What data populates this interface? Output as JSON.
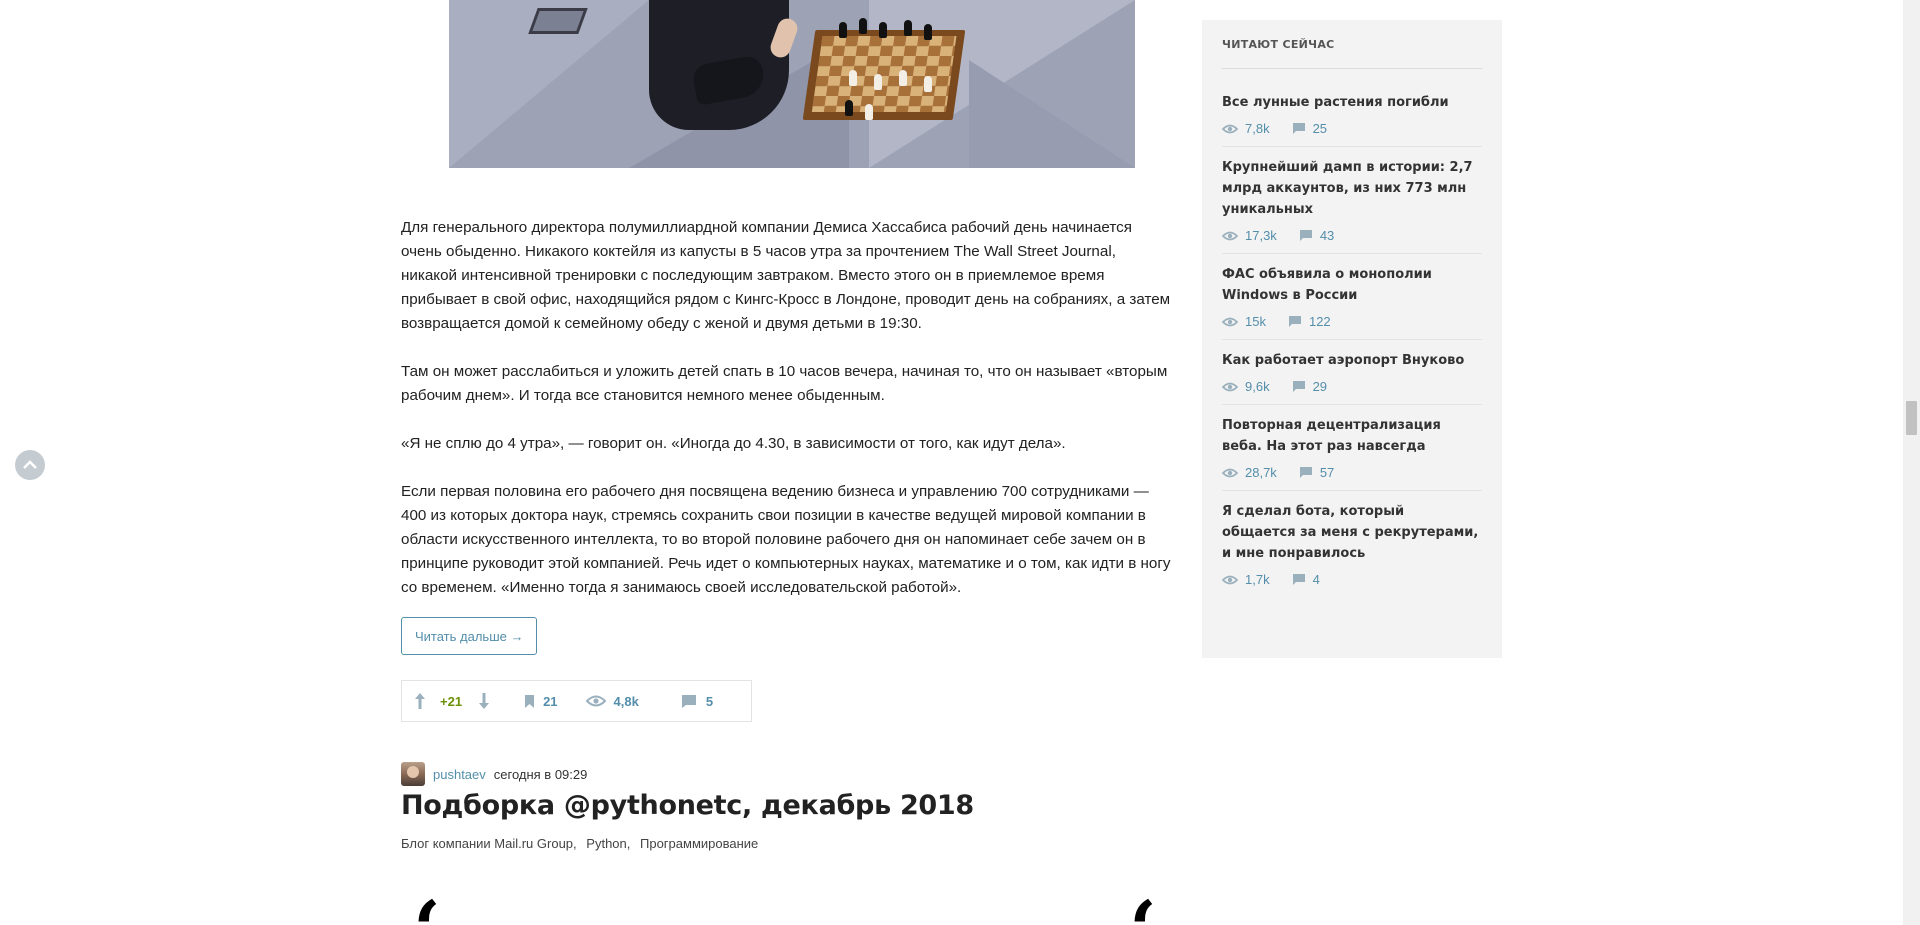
{
  "article": {
    "paragraphs": [
      "Для генерального директора полумиллиардной компании Демиса Хассабиса рабочий день начинается очень обыденно. Никакого коктейля из капусты в 5 часов утра за прочтением The Wall Street Journal, никакой интенсивной тренировки с последующим завтраком. Вместо этого он в приемлемое время прибывает в свой офис, находящийся рядом с Кингс-Кросс в Лондоне, проводит день на собраниях, а затем возвращается домой к семейному обеду с женой и двумя детьми в 19:30.",
      "Там он может расслабиться и уложить детей спать в 10 часов вечера, начиная то, что он называет «вторым рабочим днем». И тогда все становится немного менее обыденным.",
      "«Я не сплю до 4 утра», — говорит он. «Иногда до 4.30, в зависимости от того, как идут дела».",
      "Если первая половина его рабочего дня посвящена ведению бизнеса и управлению 700 сотрудниками — 400 из которых доктора наук, стремясь сохранить свои позиции в качестве ведущей мировой компании в области искусственного интеллекта, то во второй половине рабочего дня он напоминает себе зачем он в принципе руководит этой компанией. Речь идет о компьютерных науках, математике и о том, как идти в ногу со временем. «Именно тогда я занимаюсь своей исследовательской работой»."
    ],
    "read_more_label": "Читать дальше →",
    "stats": {
      "score": "+21",
      "bookmarks": "21",
      "views": "4,8k",
      "comments": "5"
    }
  },
  "next_post": {
    "author": "pushtaev",
    "time": "сегодня в 09:29",
    "title": "Подборка @pythonetc, декабрь 2018",
    "hubs": [
      "Блог компании Mail.ru Group,",
      "Python,",
      "Программирование"
    ],
    "quote_left": "‘",
    "quote_right": "‘"
  },
  "sidebar": {
    "title": "ЧИТАЮТ СЕЙЧАС",
    "items": [
      {
        "title": "Все лунные растения погибли",
        "views": "7,8k",
        "comments": "25"
      },
      {
        "title": "Крупнейший дамп в истории: 2,7 млрд аккаунтов, из них 773 млн уникальных",
        "views": "17,3k",
        "comments": "43"
      },
      {
        "title": "ФАС объявила о монополии Windows в России",
        "views": "15k",
        "comments": "122"
      },
      {
        "title": "Как работает аэропорт Внуково",
        "views": "9,6k",
        "comments": "29"
      },
      {
        "title": "Повторная децентрализация веба. На этот раз навсегда",
        "views": "28,7k",
        "comments": "57"
      },
      {
        "title": "Я сделал бота, который общается за меня с рекрутерами, и мне понравилось",
        "views": "1,7k",
        "comments": "4"
      }
    ]
  },
  "colors": {
    "accent": "#548eaa",
    "score_positive": "#6c9007",
    "sidebar_bg": "#f3f3f3"
  }
}
